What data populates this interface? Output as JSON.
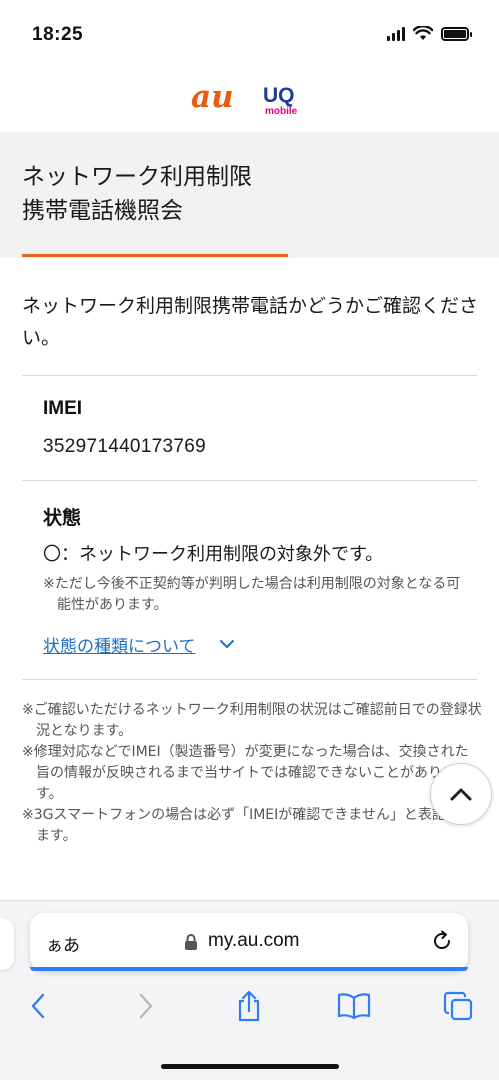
{
  "status_bar": {
    "time": "18:25"
  },
  "logos": {
    "au": "au",
    "uq": "UQ",
    "uq_sub": "mobile"
  },
  "page": {
    "title_line1": "ネットワーク利用制限",
    "title_line2": "携帯電話機照会",
    "intro": "ネットワーク利用制限携帯電話かどうかご確認ください。",
    "imei_label": "IMEI",
    "imei_value": "352971440173769",
    "status_label": "状態",
    "status_value": "〇：ネットワーク利用制限の対象外です。",
    "status_note": "※ただし今後不正契約等が判明した場合は利用制限の対象となる可能性があります。",
    "status_link": "状態の種類について",
    "notes": [
      "※ご確認いただけるネットワーク利用制限の状況はご確認前日での登録状況となります。",
      "※修理対応などでIMEI（製造番号）が変更になった場合は、交換された旨の情報が反映されるまで当サイトでは確認できないことがあります。",
      "※3Gスマートフォンの場合は必ず「IMEIが確認できません」と表記されます。"
    ]
  },
  "safari": {
    "aa": "ぁあ",
    "url": "my.au.com"
  },
  "colors": {
    "accent_orange": "#e8641e",
    "link_blue": "#1f6fbf",
    "uq_blue": "#1a3d9c",
    "uq_pink": "#e4007f"
  }
}
